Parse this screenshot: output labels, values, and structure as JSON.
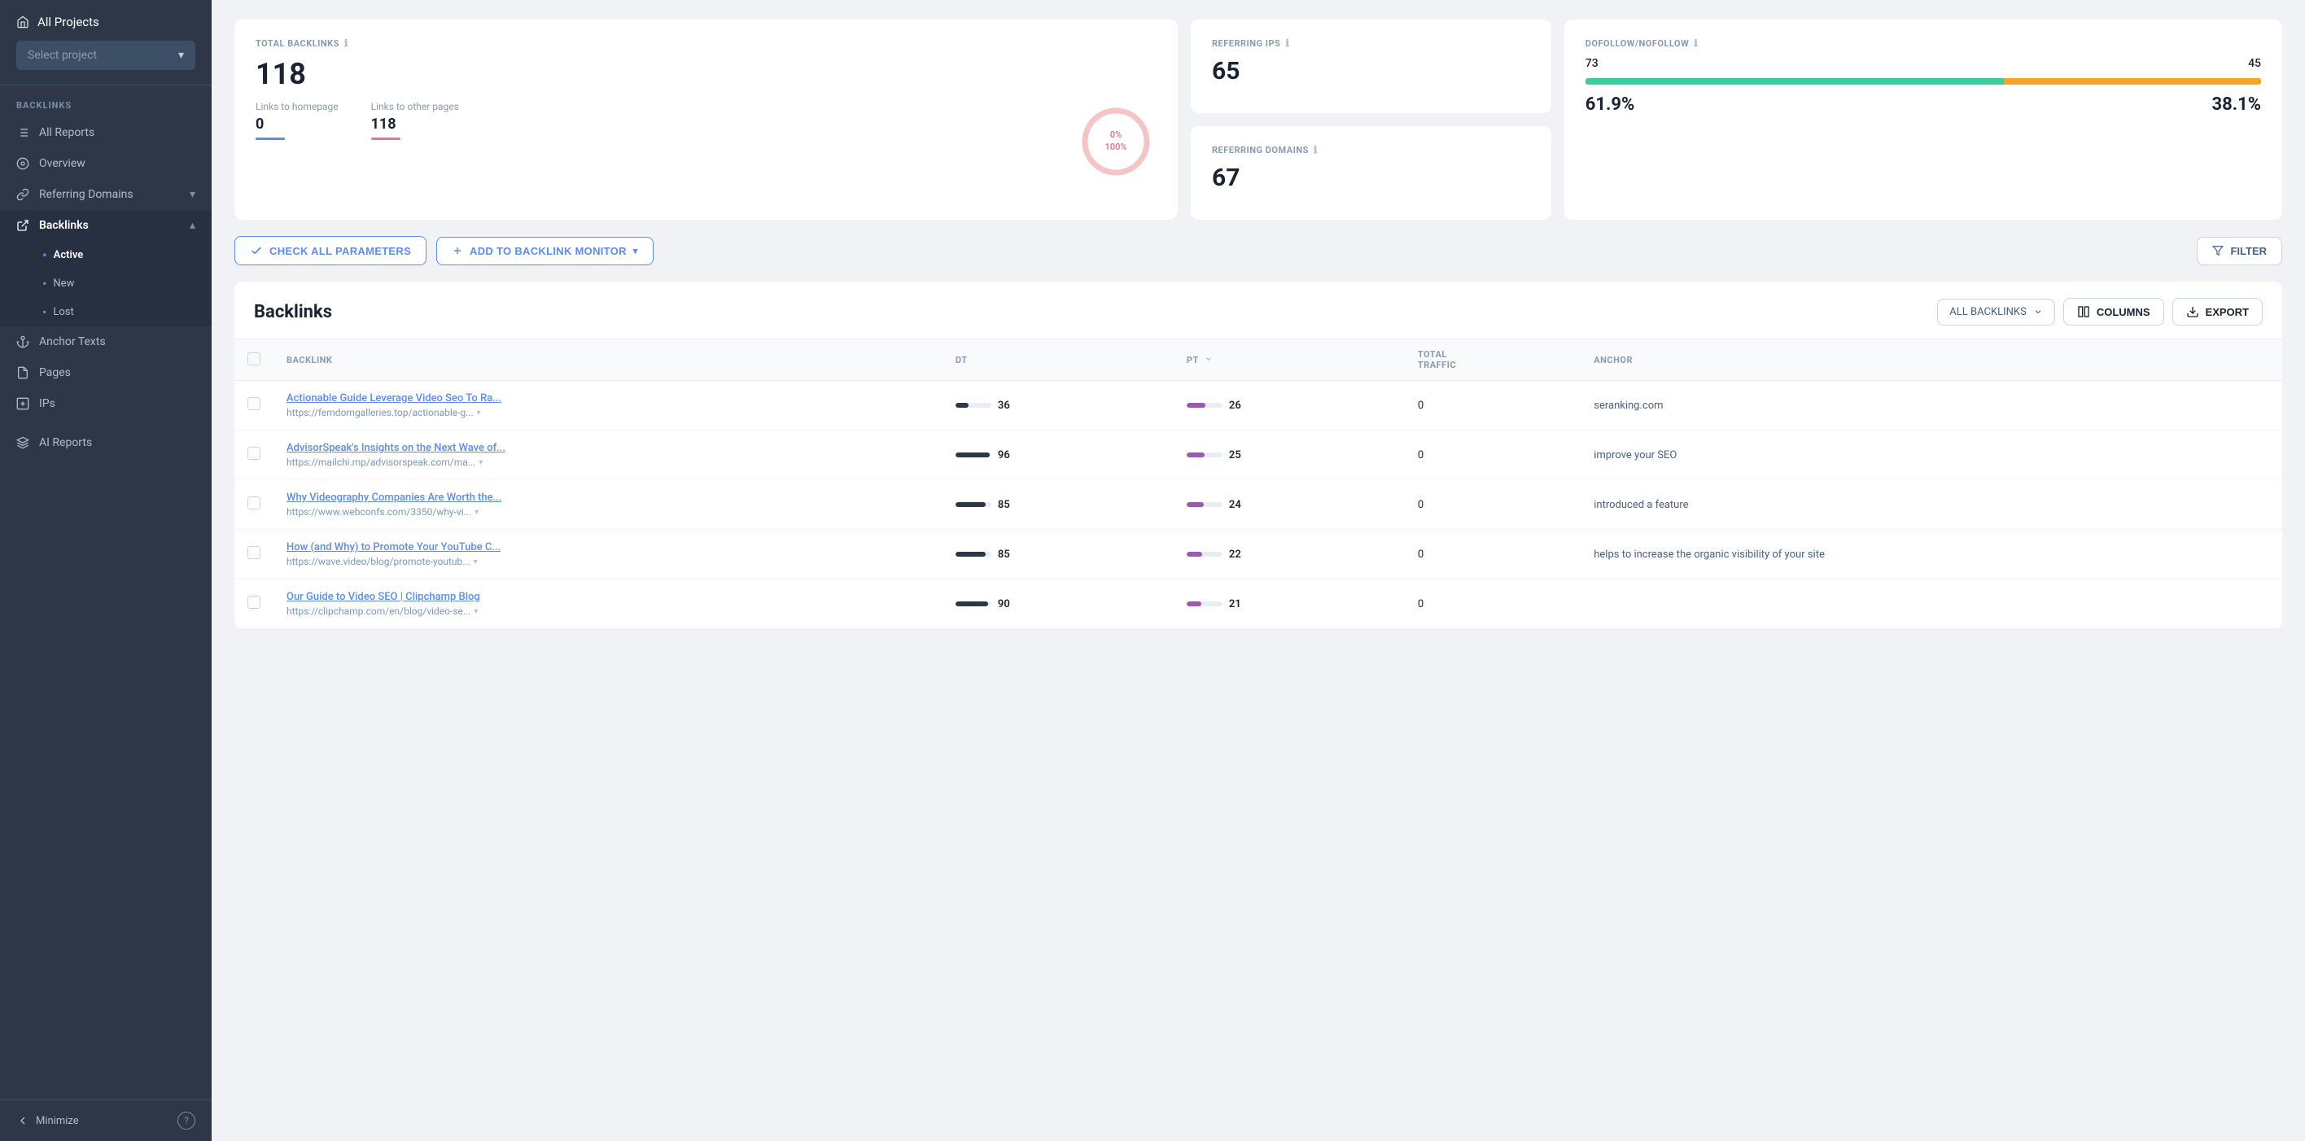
{
  "sidebar": {
    "all_projects_label": "All Projects",
    "project_placeholder": "Select project",
    "sections": [
      {
        "label": "BACKLINKS",
        "items": [
          {
            "id": "all-reports",
            "label": "All Reports",
            "icon": "list-icon"
          },
          {
            "id": "overview",
            "label": "Overview",
            "icon": "grid-icon"
          },
          {
            "id": "referring-domains",
            "label": "Referring Domains",
            "icon": "link-icon",
            "expandable": true
          },
          {
            "id": "backlinks",
            "label": "Backlinks",
            "icon": "backlink-icon",
            "expandable": true,
            "active": true,
            "subitems": [
              {
                "id": "active",
                "label": "Active",
                "active": true
              },
              {
                "id": "new",
                "label": "New"
              },
              {
                "id": "lost",
                "label": "Lost"
              }
            ]
          },
          {
            "id": "anchor-texts",
            "label": "Anchor Texts",
            "icon": "anchor-icon"
          },
          {
            "id": "pages",
            "label": "Pages",
            "icon": "pages-icon"
          },
          {
            "id": "ips",
            "label": "IPs",
            "icon": "ip-icon"
          }
        ]
      }
    ],
    "ai_reports_label": "AI Reports",
    "minimize_label": "Minimize",
    "help_label": "?"
  },
  "stats": {
    "total_backlinks": {
      "label": "TOTAL BACKLINKS",
      "value": "118",
      "links_to_homepage_label": "Links to homepage",
      "links_to_homepage_value": "0",
      "links_to_other_label": "Links to other pages",
      "links_to_other_value": "118",
      "donut_pct_inner": "0%",
      "donut_pct_outer": "100%"
    },
    "referring_ips": {
      "label": "REFERRING IPS",
      "value": "65"
    },
    "referring_domains": {
      "label": "REFERRING DOMAINS",
      "value": "67"
    },
    "dofollow": {
      "label": "DOFOLLOW/NOFOLLOW",
      "dofollow_count": "73",
      "nofollow_count": "45",
      "dofollow_pct": "61.9%",
      "nofollow_pct": "38.1%",
      "dofollow_bar_width": 61.9,
      "nofollow_bar_width": 38.1
    }
  },
  "toolbar": {
    "check_params_label": "CHECK ALL PARAMETERS",
    "add_monitor_label": "ADD TO BACKLINK MONITOR",
    "filter_label": "FILTER"
  },
  "table": {
    "title": "Backlinks",
    "dropdown_label": "ALL BACKLINKS",
    "columns_label": "COLUMNS",
    "export_label": "EXPORT",
    "columns": [
      {
        "id": "backlink",
        "label": "BACKLINK"
      },
      {
        "id": "dt",
        "label": "DT"
      },
      {
        "id": "pt",
        "label": "PT",
        "sortable": true
      },
      {
        "id": "total_traffic",
        "label": "TOTAL TRAFFIC"
      },
      {
        "id": "anchor",
        "label": "ANCHOR"
      }
    ],
    "rows": [
      {
        "title": "Actionable Guide Leverage Video Seo To Ra...",
        "url": "https://femdomgalleries.top/actionable-g...",
        "dt": 36,
        "dt_bar": 36,
        "pt": 26,
        "pt_bar": 26,
        "total_traffic": "0",
        "anchor": "seranking.com"
      },
      {
        "title": "AdvisorSpeak's Insights on the Next Wave of...",
        "url": "https://mailchi.mp/advisorspeak.com/ma...",
        "dt": 96,
        "dt_bar": 96,
        "pt": 25,
        "pt_bar": 25,
        "total_traffic": "0",
        "anchor": "improve your SEO"
      },
      {
        "title": "Why Videography Companies Are Worth the...",
        "url": "https://www.webconfs.com/3350/why-vi...",
        "dt": 85,
        "dt_bar": 85,
        "pt": 24,
        "pt_bar": 24,
        "total_traffic": "0",
        "anchor": "introduced a feature"
      },
      {
        "title": "How (and Why) to Promote Your YouTube C...",
        "url": "https://wave.video/blog/promote-youtub...",
        "dt": 85,
        "dt_bar": 85,
        "pt": 22,
        "pt_bar": 22,
        "total_traffic": "0",
        "anchor": "helps to increase the organic visibility of your site"
      },
      {
        "title": "Our Guide to Video SEO | Clipchamp Blog",
        "url": "https://clipchamp.com/en/blog/video-se...",
        "dt": 90,
        "dt_bar": 90,
        "pt": 21,
        "pt_bar": 21,
        "total_traffic": "0",
        "anchor": ""
      }
    ]
  }
}
